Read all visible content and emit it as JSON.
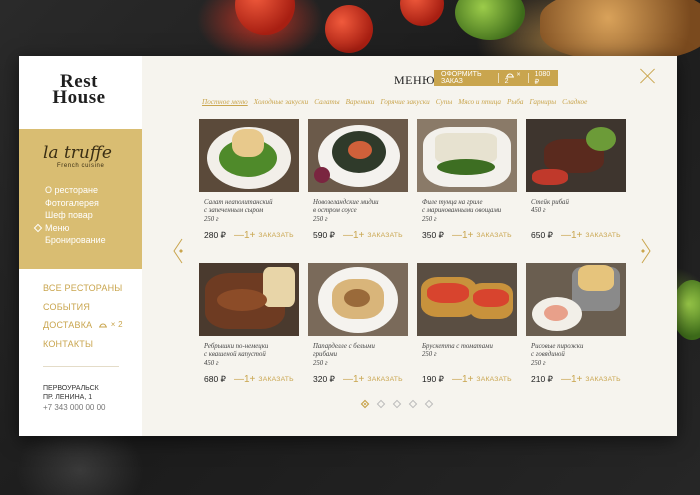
{
  "brand": {
    "line1": "Rest",
    "line2": "House"
  },
  "restaurant": {
    "name": "la truffe",
    "subtitle": "French cuisine",
    "nav": [
      "О ресторане",
      "Фотогалерея",
      "Шеф повар",
      "Меню",
      "Бронирование"
    ],
    "active_index": 3
  },
  "site_nav": {
    "items": [
      "ВСЕ РЕСТОРАНЫ",
      "СОБЫТИЯ",
      "ДОСТАВКА",
      "КОНТАКТЫ"
    ],
    "cart_count": "× 2"
  },
  "address": {
    "city": "ПЕРВОУРАЛЬСК",
    "street": "ПР. ЛЕНИНА, 1",
    "phone": "+7 343 000 00 00"
  },
  "header": {
    "title": "МЕНЮ",
    "order_button": "ОФОРМИТЬ ЗАКАЗ",
    "cart_count": "× 2",
    "cart_total": "1080 ₽"
  },
  "categories": [
    "Постное меню",
    "Холодные закуски",
    "Салаты",
    "Вареники",
    "Горячие закуски",
    "Супы",
    "Мясо и птица",
    "Рыба",
    "Гарниры",
    "Сладкое"
  ],
  "active_category": 0,
  "dishes": [
    {
      "name1": "Салат неаполитанский",
      "name2": "с запеченным сыром",
      "weight": "250 г",
      "price": "280 ₽"
    },
    {
      "name1": "Новозеландские мидии",
      "name2": "в остром соусе",
      "weight": "250 г",
      "price": "590 ₽"
    },
    {
      "name1": "Филе тунца на гриле",
      "name2": "с маринованными овощами",
      "weight": "250 г",
      "price": "350 ₽"
    },
    {
      "name1": "Стейк рибай",
      "name2": "450 г",
      "weight": "",
      "price": "650 ₽"
    },
    {
      "name1": "Ребрышки по-немецки",
      "name2": "с квашеной капустой",
      "weight": "450 г",
      "price": "680 ₽"
    },
    {
      "name1": "Папарделле с белыми",
      "name2": "грибами",
      "weight": "250 г",
      "price": "320 ₽"
    },
    {
      "name1": "Брускетта с томатами",
      "name2": "250 г",
      "weight": "",
      "price": "190 ₽"
    },
    {
      "name1": "Рисовые пирожки",
      "name2": "с говядиной",
      "weight": "250 г",
      "price": "210 ₽"
    }
  ],
  "card_controls": {
    "stepper": "—1+",
    "order": "ЗАКАЗАТЬ"
  },
  "pager": {
    "pages": 5,
    "current": 0
  },
  "colors": {
    "accent": "#c9a54e",
    "gold_block": "#d9bd72"
  }
}
